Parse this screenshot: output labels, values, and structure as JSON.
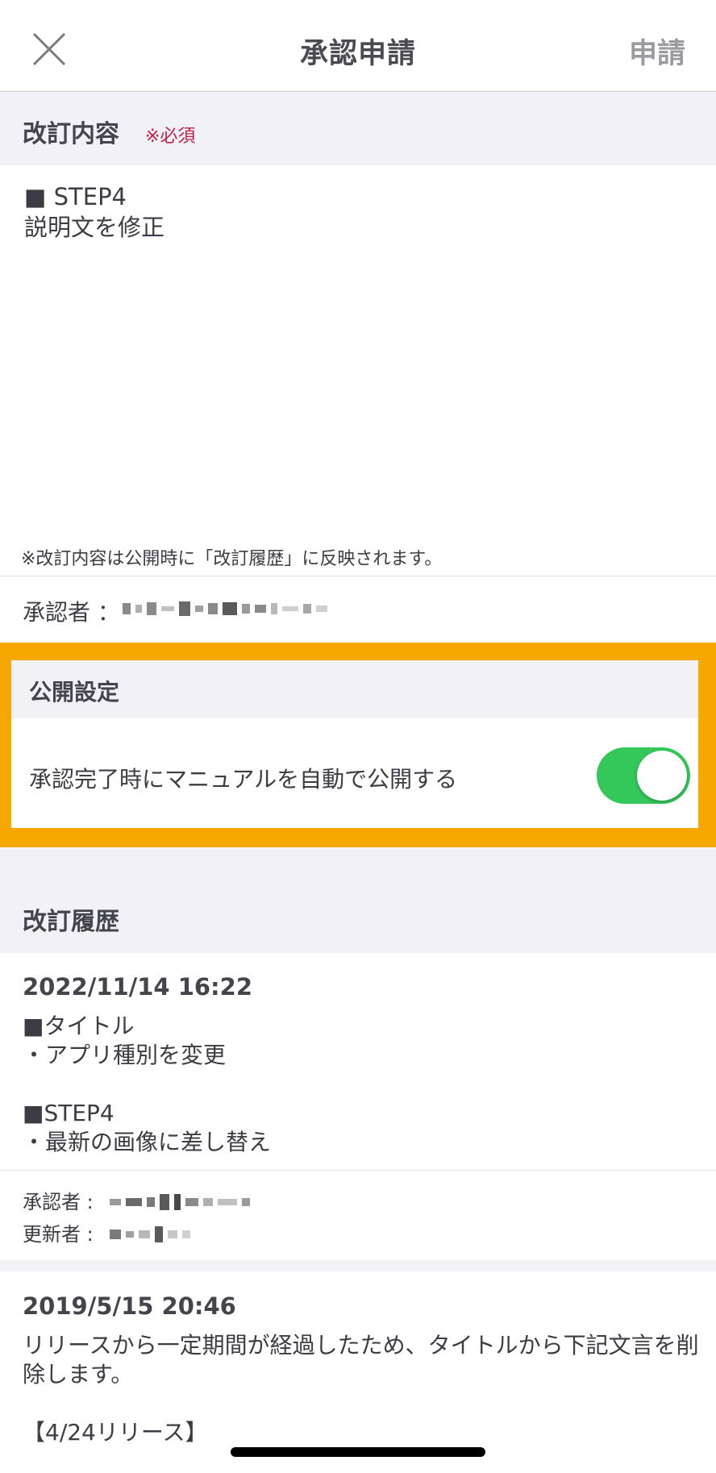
{
  "header": {
    "title": "承認申請",
    "submit_label": "申請",
    "close_icon": "close-icon"
  },
  "revision": {
    "section_label": "改訂内容",
    "required_label": "※必須",
    "content": "■ STEP4\n説明文を修正",
    "note": "※改訂内容は公開時に「改訂履歴」に反映されます。"
  },
  "approver": {
    "label": "承認者 ："
  },
  "publish": {
    "section_label": "公開設定",
    "toggle_label": "承認完了時にマニュアルを自動で公開する",
    "toggle_on": true,
    "toggle_color": "#34c759",
    "highlight_color": "#f7a800"
  },
  "history": {
    "section_label": "改訂履歴",
    "entries": [
      {
        "date": "2022/11/14 16:22",
        "text": "■タイトル\n・アプリ種別を変更\n\n■STEP4\n・最新の画像に差し替え",
        "approver_label": "承認者",
        "updater_label": "更新者"
      },
      {
        "date": "2019/5/15 20:46",
        "text": "リリースから一定期間が経過したため、タイトルから下記文言を削除します。\n\n【4/24リリース】"
      }
    ]
  }
}
